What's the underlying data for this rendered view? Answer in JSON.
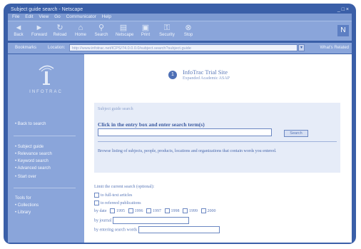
{
  "colors": {
    "frame": "#3a5fa8",
    "chrome": "#8aa5da",
    "panel": "#e6ecf8",
    "accent": "#3b5aa0"
  },
  "window": {
    "title": "Subject guide search - Netscape",
    "controls": "_ □ ×"
  },
  "menu": [
    "File",
    "Edit",
    "View",
    "Go",
    "Communicator",
    "Help"
  ],
  "toolbar": [
    {
      "label": "Back",
      "icon": "back-arrow-icon"
    },
    {
      "label": "Forward",
      "icon": "forward-arrow-icon"
    },
    {
      "label": "Reload",
      "icon": "reload-icon"
    },
    {
      "label": "Home",
      "icon": "home-icon"
    },
    {
      "label": "Search",
      "icon": "search-icon"
    },
    {
      "label": "Netscape",
      "icon": "netscape-icon"
    },
    {
      "label": "Print",
      "icon": "print-icon"
    },
    {
      "label": "Security",
      "icon": "security-icon"
    },
    {
      "label": "Stop",
      "icon": "stop-icon"
    }
  ],
  "address": {
    "bookmarks": "Bookmarks",
    "location_label": "Location:",
    "url": "http://www.infotrac.net/ICPS/74.0.0.0.0/subject.search?subject.guide",
    "go": "What's Related"
  },
  "sidebar": {
    "logo_text": "INFOTRAC",
    "back": "Back to search",
    "search_items": [
      "Subject guide",
      "Relevance search",
      "Keyword search",
      "Advanced search",
      "Start over"
    ],
    "tools_label": "Tools for",
    "tools_items": [
      "Collections",
      "Library"
    ]
  },
  "header": {
    "badge": "1",
    "title": "InfoTrac Trial Site",
    "subtitle": "Expanded Academic ASAP"
  },
  "search_panel": {
    "heading": "Subject guide search",
    "instruction": "Click in the entry box and enter search term(s)",
    "input_value": "",
    "button": "Search",
    "description": "Browse listing of subjects, people, products, locations and organizations that contain words you entered."
  },
  "limits": {
    "title": "Limit the current search (optional):",
    "opt1": "to full-text articles",
    "opt2": "to refereed publications",
    "date_label": "by date",
    "years": [
      "1995",
      "1996",
      "1997",
      "1998",
      "1999",
      "2000"
    ],
    "journal_label": "by journal",
    "words_label": "by entering search words"
  }
}
